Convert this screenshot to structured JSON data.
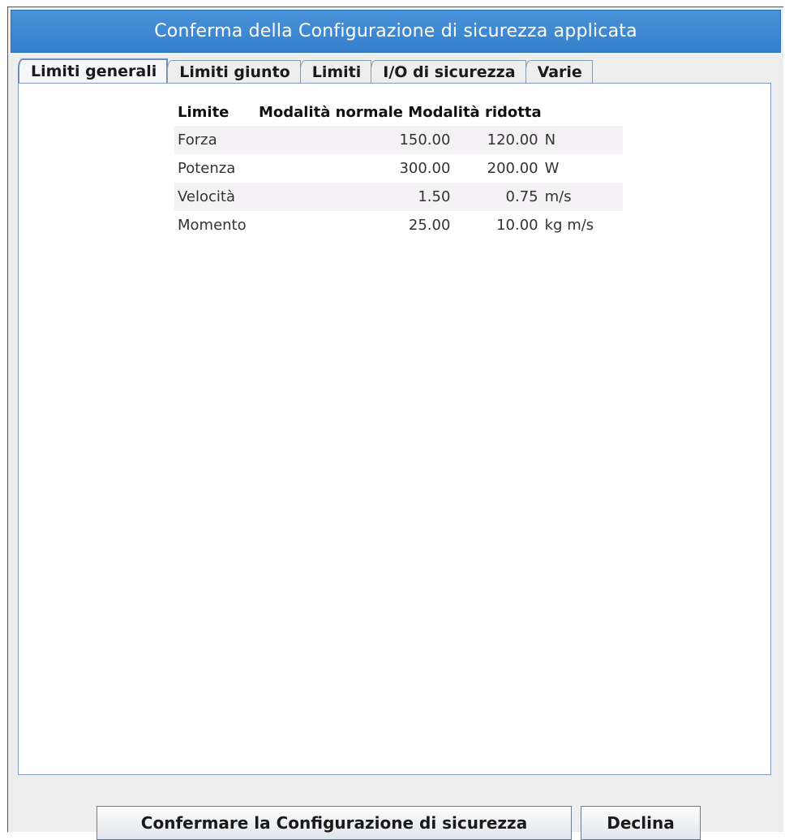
{
  "dialog": {
    "title": "Conferma della Configurazione di sicurezza applicata"
  },
  "tabs": [
    {
      "label": "Limiti generali",
      "active": true
    },
    {
      "label": "Limiti giunto",
      "active": false
    },
    {
      "label": "Limiti",
      "active": false
    },
    {
      "label": "I/O di sicurezza",
      "active": false
    },
    {
      "label": "Varie",
      "active": false
    }
  ],
  "table": {
    "headers": {
      "limit": "Limite",
      "normal": "Modalità normale",
      "reduced": "Modalità ridotta"
    },
    "rows": [
      {
        "name": "Forza",
        "normal": "150.00",
        "reduced": "120.00",
        "unit": "N"
      },
      {
        "name": "Potenza",
        "normal": "300.00",
        "reduced": "200.00",
        "unit": "W"
      },
      {
        "name": "Velocità",
        "normal": "1.50",
        "reduced": "0.75",
        "unit": "m/s"
      },
      {
        "name": "Momento",
        "normal": "25.00",
        "reduced": "10.00",
        "unit": "kg m/s"
      }
    ]
  },
  "buttons": {
    "confirm_label": "Confermare la Configurazione di sicurezza",
    "decline_label": "Declina"
  },
  "colors": {
    "titlebar": "#3c86d2",
    "panel_border": "#7f9bc2"
  }
}
